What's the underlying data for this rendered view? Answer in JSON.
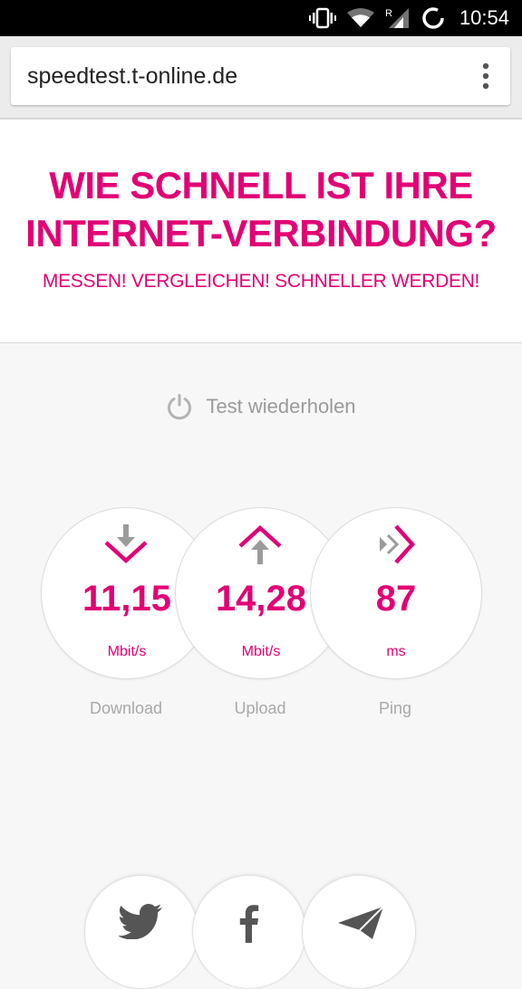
{
  "status_bar": {
    "time": "10:54",
    "icons": [
      "vibrate-icon",
      "wifi-icon",
      "cellular-roaming-icon",
      "battery-charging-icon"
    ],
    "roaming_label": "R"
  },
  "browser": {
    "url": "speedtest.t-online.de",
    "menu_icon": "more-vert-icon"
  },
  "hero": {
    "headline_line1": "WIE SCHNELL IST IHRE",
    "headline_line2": "INTERNET-VERBINDUNG?",
    "subline": "MESSEN! VERGLEICHEN! SCHNELLER WERDEN!"
  },
  "actions": {
    "repeat_label": "Test wiederholen",
    "repeat_icon": "power-icon"
  },
  "results": [
    {
      "icon": "download-icon",
      "value": "11,15",
      "unit": "Mbit/s",
      "label": "Download"
    },
    {
      "icon": "upload-icon",
      "value": "14,28",
      "unit": "Mbit/s",
      "label": "Upload"
    },
    {
      "icon": "ping-icon",
      "value": "87",
      "unit": "ms",
      "label": "Ping"
    }
  ],
  "share_buttons": [
    "twitter-icon",
    "facebook-icon",
    "send-icon"
  ],
  "colors": {
    "brand": "#e20074",
    "muted_text": "#9a9a9a",
    "icon_gray": "#9b9b9b"
  }
}
